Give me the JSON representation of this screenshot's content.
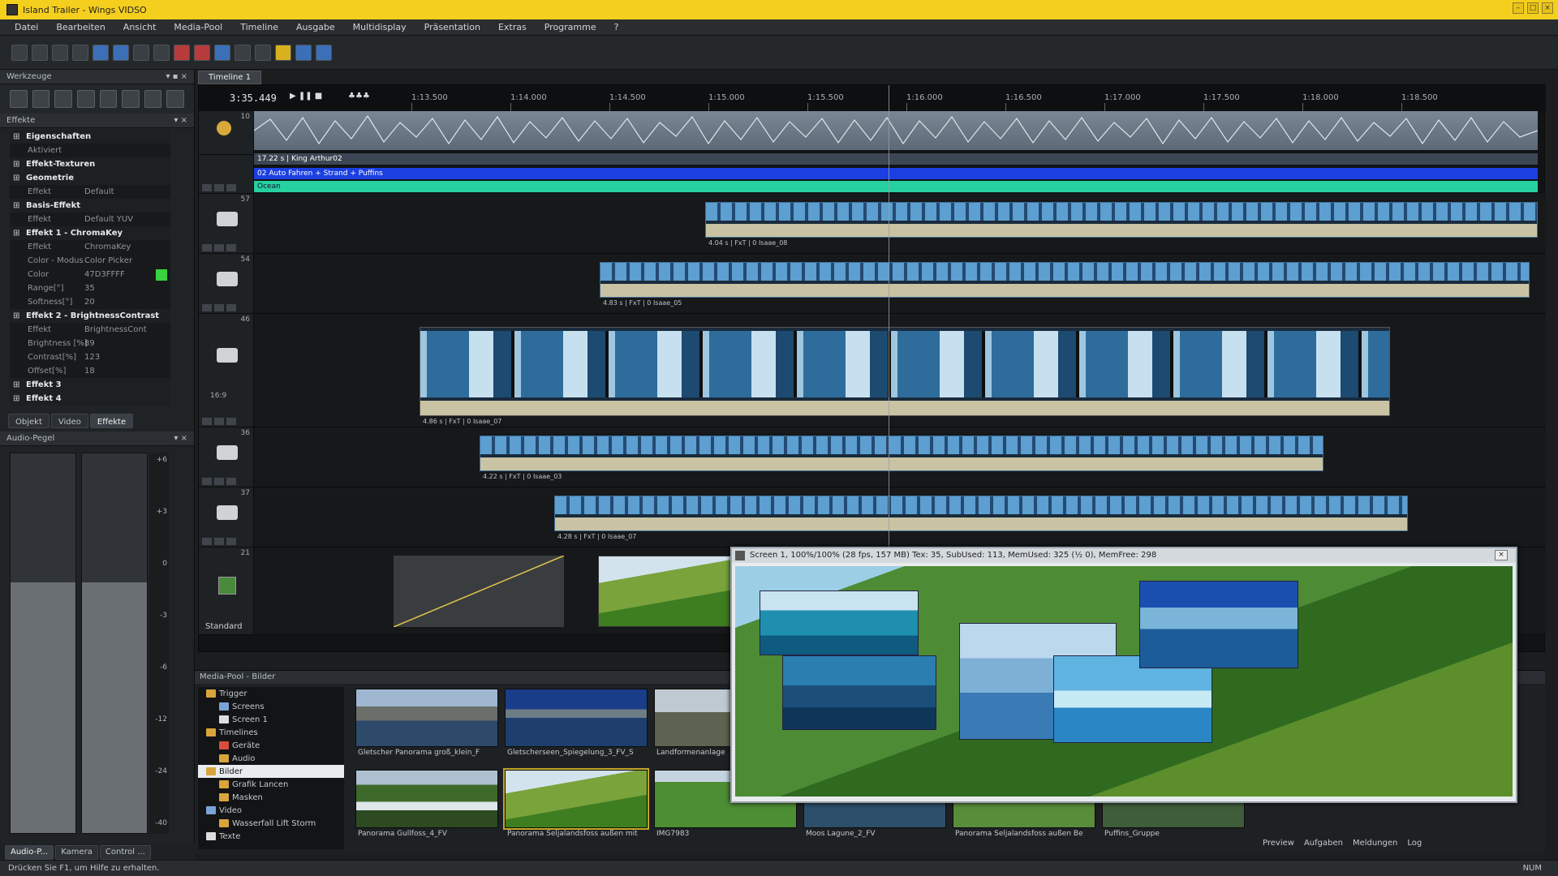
{
  "window": {
    "title": "Island Trailer - Wings VIDSO",
    "buttons": [
      "–",
      "□",
      "×"
    ]
  },
  "menu": [
    "Datei",
    "Bearbeiten",
    "Ansicht",
    "Media-Pool",
    "Timeline",
    "Ausgabe",
    "Multidisplay",
    "Präsentation",
    "Extras",
    "Programme",
    "?"
  ],
  "left": {
    "tools_header": "Werkzeuge",
    "effects_header": "Effekte",
    "tree": [
      {
        "type": "head",
        "label": "Eigenschaften"
      },
      {
        "type": "kv",
        "k": "Aktiviert",
        "v": ""
      },
      {
        "type": "head",
        "label": "Effekt-Texturen"
      },
      {
        "type": "head",
        "label": "Geometrie"
      },
      {
        "type": "kv",
        "k": "Effekt",
        "v": "Default"
      },
      {
        "type": "head",
        "label": "Basis-Effekt"
      },
      {
        "type": "kv",
        "k": "Effekt",
        "v": "Default YUV"
      },
      {
        "type": "head",
        "label": "Effekt 1 - ChromaKey"
      },
      {
        "type": "kv",
        "k": "Effekt",
        "v": "ChromaKey"
      },
      {
        "type": "kv",
        "k": "Color - Modus",
        "v": "Color Picker"
      },
      {
        "type": "kv",
        "k": "Color",
        "v": "47D3FFFF"
      },
      {
        "type": "kv",
        "k": "Range[°]",
        "v": "35"
      },
      {
        "type": "kv",
        "k": "Softness[°]",
        "v": "20"
      },
      {
        "type": "head",
        "label": "Effekt 2 - BrightnessContrast"
      },
      {
        "type": "kv",
        "k": "Effekt",
        "v": "BrightnessCont"
      },
      {
        "type": "kv",
        "k": "Brightness [%]",
        "v": "89"
      },
      {
        "type": "kv",
        "k": "Contrast[%]",
        "v": "123"
      },
      {
        "type": "kv",
        "k": "Offset[%]",
        "v": "18"
      },
      {
        "type": "head",
        "label": "Effekt 3"
      },
      {
        "type": "head",
        "label": "Effekt 4"
      }
    ],
    "swatch_color": "#39d13f",
    "tabs": [
      "Objekt",
      "Video",
      "Effekte"
    ],
    "audio_header": "Audio-Pegel",
    "meter_scale": [
      "+6",
      "+3",
      "0",
      "-3",
      "-6",
      "-12",
      "-24",
      "-40"
    ],
    "bottom_tabs": [
      "Audio-P...",
      "Kamera",
      "Control ..."
    ]
  },
  "timeline": {
    "tab_label": "Timeline 1",
    "timecode": "3:35.449",
    "ruler": [
      "1:13.500",
      "1:14.000",
      "1:14.500",
      "1:15.000",
      "1:15.500",
      "1:16.000",
      "1:16.500",
      "1:17.000",
      "1:17.500",
      "1:18.000",
      "1:18.500"
    ],
    "tracks": {
      "audio_num": "10",
      "audio_label": "17.22 s | King Arthur02",
      "blue_bar": "02 Auto Fahren + Strand + Puffins",
      "teal_bar": "Ocean",
      "t57": "57",
      "t54": "54",
      "t46": "46",
      "t46_sub": "16:9",
      "t36": "36",
      "t37": "37",
      "t21": "21",
      "std_label": "Standard"
    },
    "clip_labels": {
      "c57": "4.04 s | FxT | 0 Isaae_08",
      "c54": "4.83 s | FxT | 0 Isaae_05",
      "c46": "4.86 s | FxT | 0 Isaae_07",
      "c36": "4.22 s | FxT | 0 Isaae_03",
      "c37": "4.28 s | FxT | 0 Isaae_07"
    }
  },
  "mediapool": {
    "header": "Media-Pool - Bilder",
    "tree": [
      {
        "label": "Trigger",
        "c": "fld"
      },
      {
        "label": "Screens",
        "c": "fld blue"
      },
      {
        "label": "Screen 1",
        "c": "fld white"
      },
      {
        "label": "Timelines",
        "c": "fld"
      },
      {
        "label": "Geräte",
        "c": "fld red"
      },
      {
        "label": "Audio",
        "c": "fld"
      },
      {
        "label": "Bilder",
        "c": "fld",
        "sel": true
      },
      {
        "label": "Grafik Lancen",
        "c": "fld"
      },
      {
        "label": "Masken",
        "c": "fld"
      },
      {
        "label": "Video",
        "c": "fld blue"
      },
      {
        "label": "Wasserfall Lift Storm",
        "c": "fld"
      },
      {
        "label": "Texte",
        "c": "fld white"
      }
    ],
    "thumbs": [
      {
        "cap": "Gletscher Panorama groß_klein_F"
      },
      {
        "cap": "Gletscherseen_Spiegelung_3_FV_S"
      },
      {
        "cap": "Landformenanlage"
      },
      {
        "cap": "Panorama Gullfoss_4_FV"
      },
      {
        "cap": "Panorama Seljalandsfoss außen mit"
      },
      {
        "cap": "IMG7983"
      },
      {
        "cap": "Moos Lagune_2_FV"
      },
      {
        "cap": "Panorama Seljalandsfoss außen Be"
      },
      {
        "cap": "Puffins_Gruppe"
      }
    ]
  },
  "preview": {
    "title": "Screen 1, 100%/100% (28 fps, 157 MB)  Tex: 35, SubUsed: 113, MemUsed: 325 (½ 0), MemFree: 298"
  },
  "right_tabs": [
    "Preview",
    "Aufgaben",
    "Meldungen",
    "Log"
  ],
  "status": {
    "text": "Drücken Sie F1, um Hilfe zu erhalten.",
    "indicator": "NUM"
  }
}
